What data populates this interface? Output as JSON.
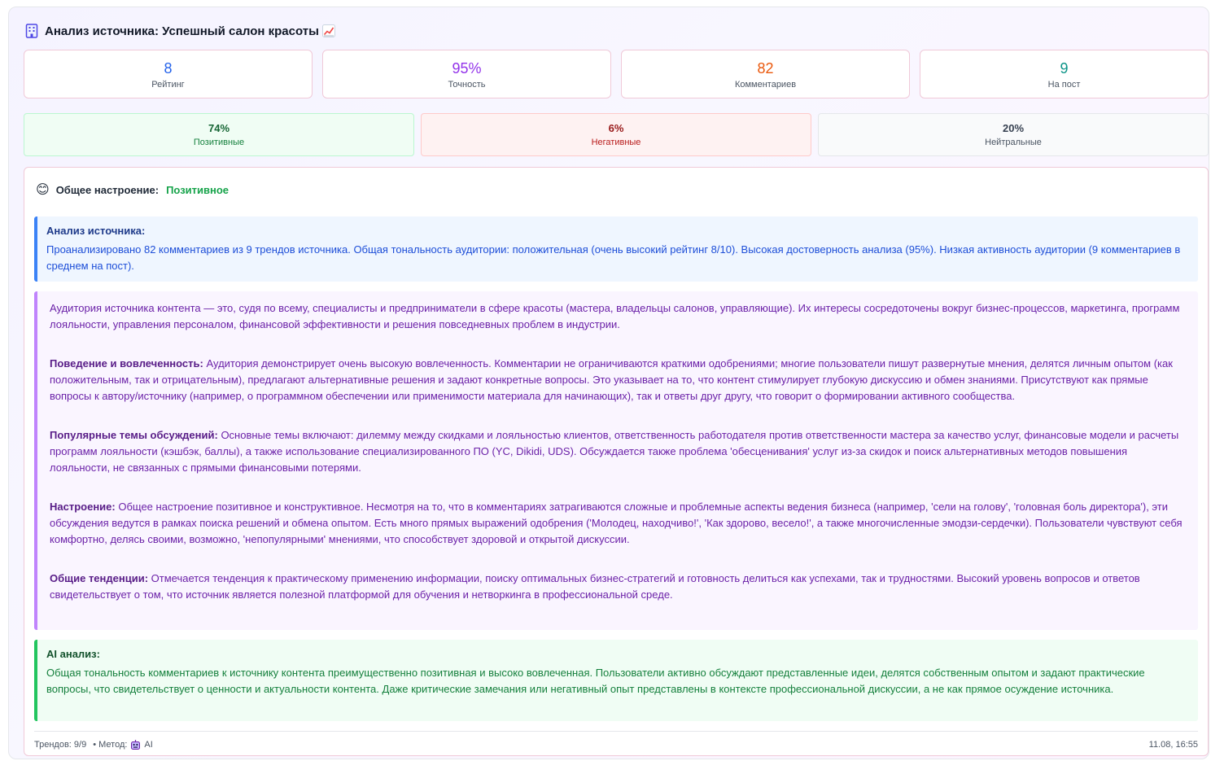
{
  "header": {
    "title": "Анализ источника: Успешный салон красоты",
    "icon": "building-icon",
    "trend_icon": "chart-increasing-icon"
  },
  "stats": [
    {
      "value": "8",
      "label": "Рейтинг",
      "color": "#2563eb"
    },
    {
      "value": "95%",
      "label": "Точность",
      "color": "#9333ea"
    },
    {
      "value": "82",
      "label": "Комментариев",
      "color": "#ea580c"
    },
    {
      "value": "9",
      "label": "На пост",
      "color": "#0d9488"
    }
  ],
  "sentiment": {
    "positive": {
      "value": "74%",
      "label": "Позитивные"
    },
    "negative": {
      "value": "6%",
      "label": "Негативные"
    },
    "neutral": {
      "value": "20%",
      "label": "Нейтральные"
    }
  },
  "mood": {
    "emoji": "😊",
    "label": "Общее настроение:",
    "value": "Позитивное"
  },
  "source_analysis": {
    "title": "Анализ источника:",
    "text": "Проанализировано 82 комментариев из 9 трендов источника. Общая тональность аудитории: положительная (очень высокий рейтинг 8/10). Высокая достоверность анализа (95%). Низкая активность аудитории (9 комментариев в среднем на пост)."
  },
  "detailed": {
    "intro": "Аудитория источника контента — это, судя по всему, специалисты и предприниматели в сфере красоты (мастера, владельцы салонов, управляющие). Их интересы сосредоточены вокруг бизнес-процессов, маркетинга, программ лояльности, управления персоналом, финансовой эффективности и решения повседневных проблем в индустрии.",
    "behavior_title": "Поведение и вовлеченность:",
    "behavior_text": " Аудитория демонстрирует очень высокую вовлеченность. Комментарии не ограничиваются краткими одобрениями; многие пользователи пишут развернутые мнения, делятся личным опытом (как положительным, так и отрицательным), предлагают альтернативные решения и задают конкретные вопросы. Это указывает на то, что контент стимулирует глубокую дискуссию и обмен знаниями. Присутствуют как прямые вопросы к автору/источнику (например, о программном обеспечении или применимости материала для начинающих), так и ответы друг другу, что говорит о формировании активного сообщества.",
    "topics_title": "Популярные темы обсуждений:",
    "topics_text": " Основные темы включают: дилемму между скидками и лояльностью клиентов, ответственность работодателя против ответственности мастера за качество услуг, финансовые модели и расчеты программ лояльности (кэшбэк, баллы), а также использование специализированного ПО (YC, Dikidi, UDS). Обсуждается также проблема 'обесценивания' услуг из-за скидок и поиск альтернативных методов повышения лояльности, не связанных с прямыми финансовыми потерями.",
    "mood_title": "Настроение:",
    "mood_text": " Общее настроение позитивное и конструктивное. Несмотря на то, что в комментариях затрагиваются сложные и проблемные аспекты ведения бизнеса (например, 'сели на голову', 'головная боль директора'), эти обсуждения ведутся в рамках поиска решений и обмена опытом. Есть много прямых выражений одобрения ('Молодец, находчиво!', 'Как здорово, весело!', а также многочисленные эмодзи-сердечки). Пользователи чувствуют себя комфортно, делясь своими, возможно, 'непопулярными' мнениями, что способствует здоровой и открытой дискуссии.",
    "trends_title": "Общие тенденции:",
    "trends_text": " Отмечается тенденция к практическому применению информации, поиску оптимальных бизнес-стратегий и готовность делиться как успехами, так и трудностями. Высокий уровень вопросов и ответов свидетельствует о том, что источник является полезной платформой для обучения и нетворкинга в профессиональной среде."
  },
  "ai_analysis": {
    "title": "AI анализ:",
    "text": "Общая тональность комментариев к источнику контента преимущественно позитивная и высоко вовлеченная. Пользователи активно обсуждают представленные идеи, делятся собственным опытом и задают практические вопросы, что свидетельствует о ценности и актуальности контента. Даже критические замечания или негативный опыт представлены в контексте профессиональной дискуссии, а не как прямое осуждение источника."
  },
  "footer": {
    "trends": "Трендов: 9/9",
    "method_label": "• Метод:",
    "method_icon": "robot-icon",
    "method_value": "AI",
    "timestamp": "11.08, 16:55"
  }
}
